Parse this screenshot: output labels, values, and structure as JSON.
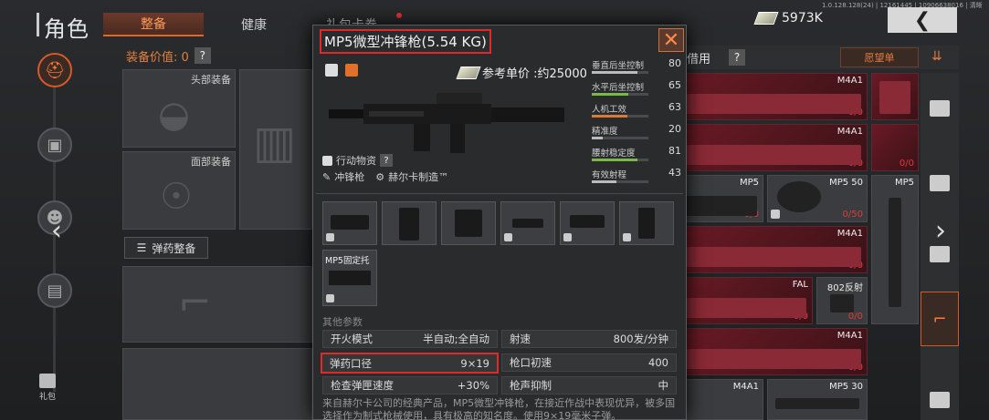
{
  "header": {
    "title": "角色",
    "tabs": [
      {
        "label": "整备",
        "active": true
      },
      {
        "label": "健康",
        "active": false
      },
      {
        "label": "礼包卡券",
        "active": false
      }
    ],
    "money": "5973K",
    "build_info": "1.0.128.128(24) | 12161445 | 10906638016 | 清晰"
  },
  "left_rail": {
    "gift_label": "礼包"
  },
  "equipment": {
    "value_label": "装备价值: 0",
    "help": "?",
    "head_slot": "头部装备",
    "face_slot": "面部装备",
    "ammo_button": "弹药整备"
  },
  "popup": {
    "title": "MP5微型冲锋枪(5.54 KG)",
    "price": "参考单价 :约25000",
    "tags": [
      "行动物资",
      "冲锋枪",
      "赫尔卡制造™"
    ],
    "tag_help": "?",
    "stats": [
      {
        "label": "垂直后坐控制",
        "value": "80",
        "fill": 0.8,
        "color": "grey"
      },
      {
        "label": "水平后坐控制",
        "value": "65",
        "fill": 0.65,
        "color": "green"
      },
      {
        "label": "人机工效",
        "value": "63",
        "fill": 0.63,
        "color": "orange"
      },
      {
        "label": "精准度",
        "value": "20",
        "fill": 0.2,
        "color": "grey"
      },
      {
        "label": "腰射稳定度",
        "value": "81",
        "fill": 0.81,
        "color": "green"
      },
      {
        "label": "有效射程",
        "value": "43",
        "fill": 0.43,
        "color": "grey"
      }
    ],
    "attachment_label": "MP5固定托",
    "other_params_title": "其他参数",
    "params_left": [
      {
        "label": "开火模式",
        "value": "半自动;全自动"
      },
      {
        "label": "弹药口径",
        "value": "9×19",
        "highlight": true
      },
      {
        "label": "检查弹匣速度",
        "value": "+30%"
      }
    ],
    "params_right": [
      {
        "label": "射速",
        "value": "800发/分钟"
      },
      {
        "label": "枪口初速",
        "value": "400"
      },
      {
        "label": "枪声抑制",
        "value": "中"
      }
    ],
    "description": "来自赫尔卡公司的经典产品，MP5微型冲锋枪，在接近作战中表现优异，被多国选择作为制式枪械使用，具有极高的知名度。使用9×19毫米子弹。"
  },
  "right_panel": {
    "borrow_label": "借用",
    "help": "?",
    "wishlist": "愿望单",
    "items": [
      {
        "name": "M4A1",
        "count": "0/0",
        "style": "red"
      },
      {
        "name": "M4A1",
        "count": "0/0",
        "style": "red"
      },
      {
        "name": "MP5",
        "count": "0/0",
        "style": "grey"
      },
      {
        "name": "MP5 50",
        "count": "0/50",
        "style": "grey"
      },
      {
        "name": "MP5",
        "count": "",
        "style": "grey"
      },
      {
        "name": "M4A1",
        "count": "0/0",
        "style": "red"
      },
      {
        "name": "FAL",
        "count": "0/0",
        "style": "red"
      },
      {
        "name": "802反射",
        "count": "0/0",
        "style": "grey"
      },
      {
        "name": "M4A1",
        "count": "0/0",
        "style": "red"
      },
      {
        "name": "M4A1",
        "count": "",
        "style": "grey"
      },
      {
        "name": "MP5 30",
        "count": "",
        "style": "grey"
      }
    ]
  }
}
